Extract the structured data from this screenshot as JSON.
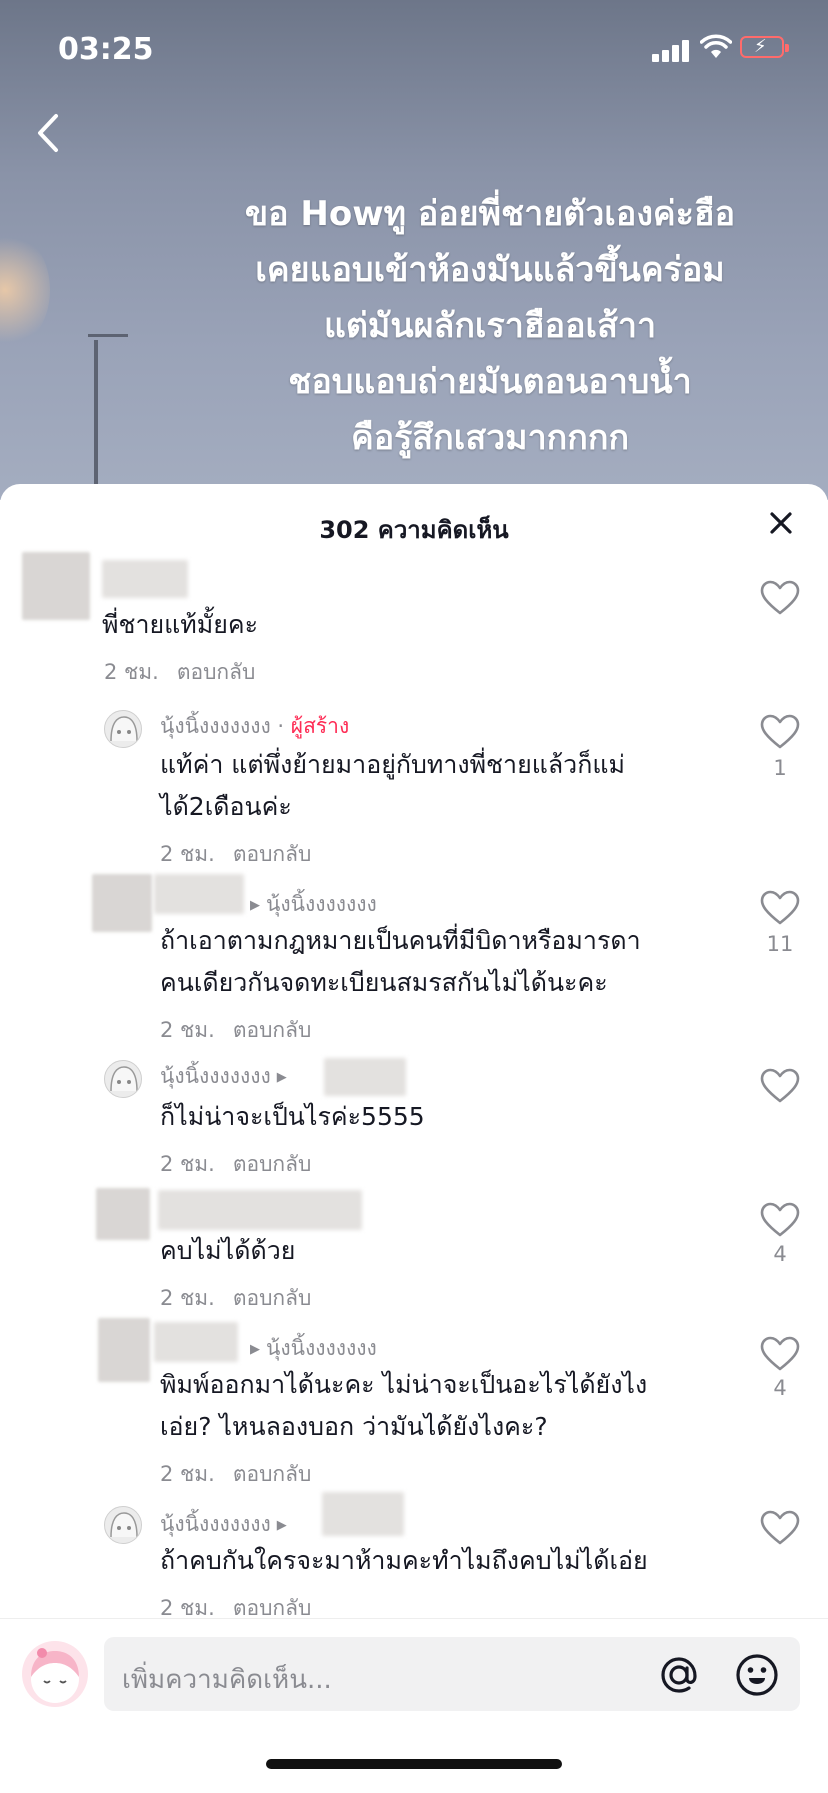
{
  "status": {
    "time": "03:25"
  },
  "video": {
    "caption_lines": [
      "ขอ Howทู อ่อยพี่ชายตัวเองค่ะฮือ",
      "เคยแอบเข้าห้องมันแล้วขึ้นคร่อม",
      "แต่มันผลักเราฮืออเส้าา",
      "ชอบแอบถ่ายมันตอนอาบน้ำ",
      "คือรู้สึกเสวมากกกก"
    ]
  },
  "comments_sheet": {
    "title": "302 ความคิดเห็น",
    "comments": [
      {
        "text_lines": [
          "พี่ชายแท้มั้ยคะ"
        ],
        "time": "2 ชม.",
        "reply": "ตอบกลับ",
        "likes": ""
      },
      {
        "username": "นุ้งนิ้งงงงงงง",
        "creator_sep": " · ",
        "creator_label": "ผู้สร้าง",
        "text_lines": [
          "แท้ค่า แต่พึ่งย้ายมาอยู่กับทางพี่ชายแล้วก็แม่",
          "ได้2เดือนค่ะ"
        ],
        "time": "2 ชม.",
        "reply": "ตอบกลับ",
        "likes": "1"
      },
      {
        "reply_to": "นุ้งนิ้งงงงงงง",
        "text_lines": [
          "ถ้าเอาตามกฎหมายเป็นคนที่มีบิดาหรือมารดา",
          "คนเดียวกันจดทะเบียนสมรสกันไม่ได้นะคะ"
        ],
        "time": "2 ชม.",
        "reply": "ตอบกลับ",
        "likes": "11"
      },
      {
        "username": "นุ้งนิ้งงงงงงง",
        "text_lines": [
          "ก็ไม่น่าจะเป็นไรค่ะ5555"
        ],
        "time": "2 ชม.",
        "reply": "ตอบกลับ",
        "likes": ""
      },
      {
        "text_lines": [
          "คบไม่ได้ด้วย"
        ],
        "time": "2 ชม.",
        "reply": "ตอบกลับ",
        "likes": "4"
      },
      {
        "reply_to": "นุ้งนิ้งงงงงงง",
        "text_lines": [
          "พิมพ์ออกมาได้นะคะ ไม่น่าจะเป็นอะไรได้ยังไง",
          "เอ่ย? ไหนลองบอก ว่ามันได้ยังไงคะ?"
        ],
        "time": "2 ชม.",
        "reply": "ตอบกลับ",
        "likes": "4"
      },
      {
        "username": "นุ้งนิ้งงงงงงง",
        "text_lines": [
          "ถ้าคบกันใครจะมาห้ามคะทำไมถึงคบไม่ได้เอ่ย"
        ],
        "time": "2 ชม.",
        "reply": "ตอบกลับ",
        "likes": ""
      }
    ]
  },
  "input": {
    "placeholder": "เพิ่มความคิดเห็น..."
  },
  "colors": {
    "accent": "#fe2c55",
    "muted": "#8a8b91",
    "text": "#161823"
  }
}
